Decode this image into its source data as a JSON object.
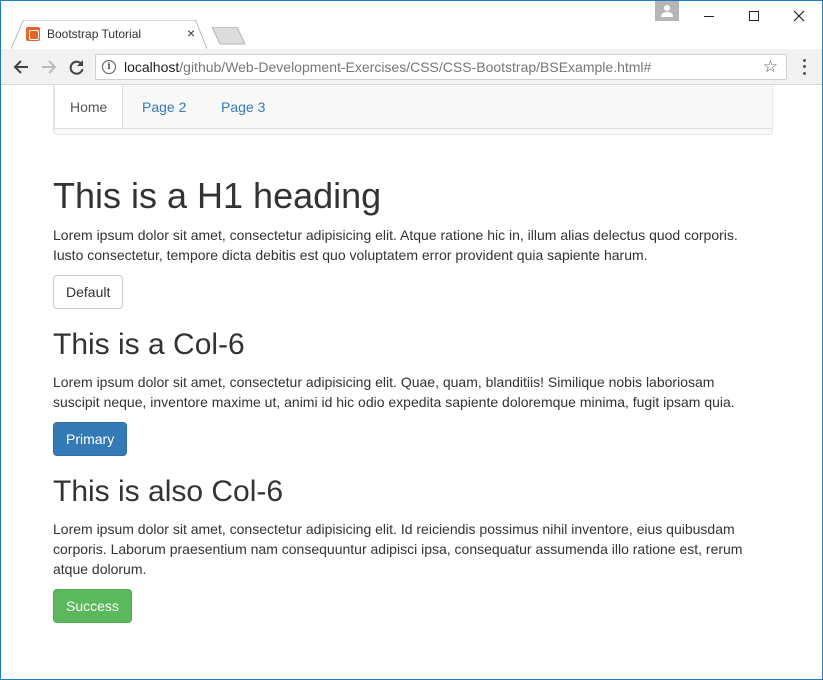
{
  "browser": {
    "tab_title": "Bootstrap Tutorial",
    "tab_close": "×",
    "url_host": "localhost",
    "url_path": "/github/Web-Development-Exercises/CSS/CSS-Bootstrap/BSExample.html#",
    "icons": [
      "favicon-icon",
      "close-icon",
      "new-tab-icon",
      "profile-icon",
      "minimize-icon",
      "maximize-icon",
      "close-window-icon",
      "back-icon",
      "forward-icon",
      "reload-icon",
      "info-icon",
      "star-icon",
      "menu-icon"
    ]
  },
  "nav": {
    "tabs": [
      {
        "label": "Home",
        "active": true
      },
      {
        "label": "Page 2",
        "active": false
      },
      {
        "label": "Page 3",
        "active": false
      }
    ]
  },
  "content": {
    "h1": "This is a H1 heading",
    "p1": "Lorem ipsum dolor sit amet, consectetur adipisicing elit. Atque ratione hic in, illum alias delectus quod corporis. Iusto consectetur, tempore dicta debitis est quo voluptatem error provident quia sapiente harum.",
    "btn_default": "Default",
    "h2a": "This is a Col-6",
    "p2": "Lorem ipsum dolor sit amet, consectetur adipisicing elit. Quae, quam, blanditiis! Similique nobis laboriosam suscipit neque, inventore maxime ut, animi id hic odio expedita sapiente doloremque minima, fugit ipsam quia.",
    "btn_primary": "Primary",
    "h2b": "This is also Col-6",
    "p3": "Lorem ipsum dolor sit amet, consectetur adipisicing elit. Id reiciendis possimus nihil inventore, eius quibusdam corporis. Laborum praesentium nam consequuntur adipisci ipsa, consequatur assumenda illo ratione est, rerum atque dolorum.",
    "btn_success": "Success"
  },
  "colors": {
    "link": "#337ab7",
    "primary": "#337ab7",
    "success": "#5cb85c",
    "window_border": "#1b7fbf"
  }
}
